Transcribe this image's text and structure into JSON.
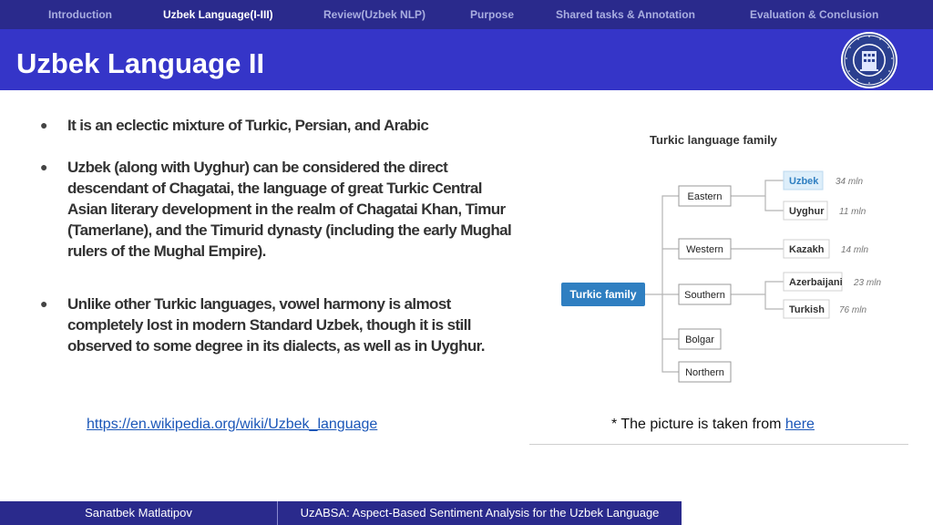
{
  "nav": {
    "items": [
      {
        "label": "Introduction"
      },
      {
        "label": "Uzbek Language(I-III)"
      },
      {
        "label": "Review(Uzbek NLP)"
      },
      {
        "label": "Purpose"
      },
      {
        "label": "Shared tasks & Annotation"
      },
      {
        "label": "Evaluation & Conclusion"
      }
    ],
    "active_index": 1
  },
  "header": {
    "title": "Uzbek Language II"
  },
  "bullets": [
    {
      "text": "It is an eclectic mixture of Turkic, Persian, and Arabic"
    },
    {
      "text": "Uzbek (along with Uyghur) can be considered the direct descendant of Chagatai, the language of great Turkic Central Asian literary development in the realm of Chagatai Khan, Timur (Tamerlane), and the Timurid dynasty (including the early Mughal rulers of the Mughal Empire)."
    },
    {
      "text": "Unlike other Turkic languages, vowel harmony is almost completely lost in modern Standard Uzbek, though it is still observed to some degree in its dialects, as well as in Uyghur."
    }
  ],
  "source_link": "https://en.wikipedia.org/wiki/Uzbek_language",
  "caption": {
    "prefix": "* The picture is taken from ",
    "link": "here"
  },
  "diagram": {
    "title": "Turkic language family",
    "root": "Turkic family",
    "branches": [
      {
        "name": "Eastern",
        "children": [
          {
            "name": "Uzbek",
            "speakers": "34 mln",
            "highlight": true
          },
          {
            "name": "Uyghur",
            "speakers": "11 mln"
          }
        ]
      },
      {
        "name": "Western",
        "children": [
          {
            "name": "Kazakh",
            "speakers": "14 mln"
          }
        ]
      },
      {
        "name": "Southern",
        "children": [
          {
            "name": "Azerbaijani",
            "speakers": "23 mln"
          },
          {
            "name": "Turkish",
            "speakers": "76 mln"
          }
        ]
      },
      {
        "name": "Bolgar",
        "children": []
      },
      {
        "name": "Northern",
        "children": []
      }
    ],
    "colors": {
      "root_fill": "#2f7fc1",
      "highlight_fill": "#ddeefa",
      "highlight_text": "#2f7fc1",
      "box_border": "#9a9a9a",
      "line": "#b5b5b5"
    }
  },
  "footer": {
    "author": "Sanatbek Matlatipov",
    "title": "UzABSA: Aspect-Based Sentiment Analysis for the Uzbek Language"
  },
  "colors": {
    "nav_bg": "#2a2a8c",
    "title_bg": "#3535c8",
    "link": "#1a56b8"
  }
}
